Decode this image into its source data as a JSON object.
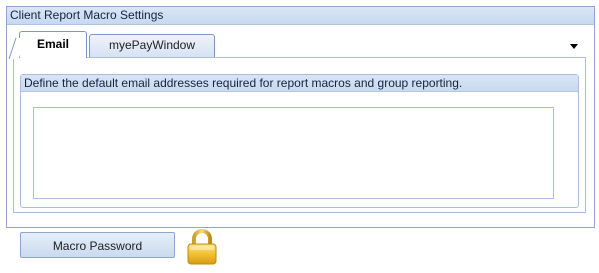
{
  "group": {
    "title": "Client Report Macro Settings"
  },
  "tabs": [
    {
      "label": "Email",
      "selected": true
    },
    {
      "label": "myePayWindow",
      "selected": false
    }
  ],
  "email_panel": {
    "description": "Define the default email addresses required for report macros and group reporting.",
    "addresses_value": ""
  },
  "footer": {
    "macro_password_label": "Macro Password",
    "lock_icon": "padlock-icon"
  },
  "colors": {
    "accent_border": "#8ea6cf",
    "header_fill": "#c8d8ef",
    "lock_gold": "#f2c230"
  }
}
